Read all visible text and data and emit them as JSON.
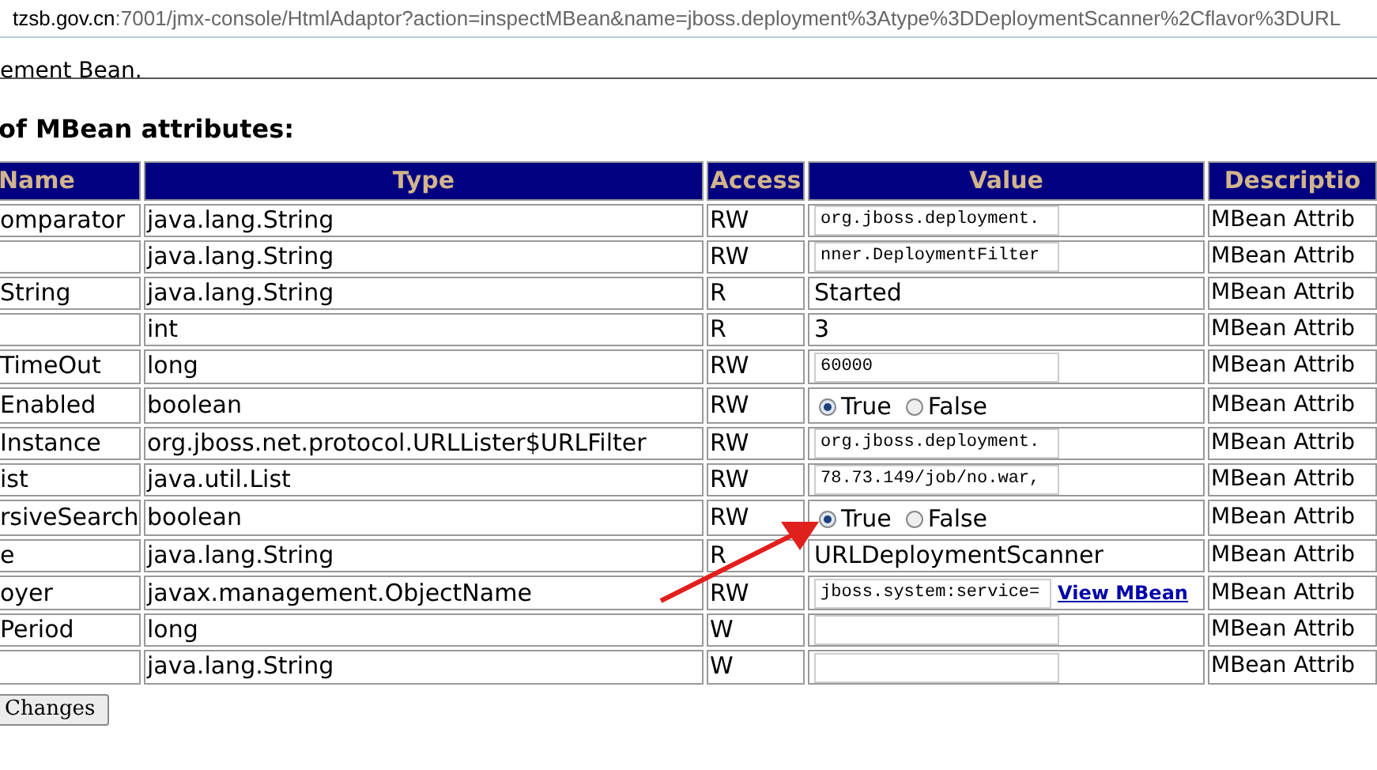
{
  "address_bar": {
    "host": "tzsb.gov.cn",
    "path": ":7001/jmx-console/HtmlAdaptor?action=inspectMBean&name=jboss.deployment%3Atype%3DDeploymentScanner%2Cflavor%3DURL"
  },
  "intro_text": "ement Bean.",
  "heading": "of MBean attributes:",
  "table": {
    "columns": [
      "Name",
      "Type",
      "Access",
      "Value",
      "Descriptio"
    ],
    "rows": [
      {
        "name": "omparator",
        "type": "java.lang.String",
        "access": "RW",
        "value": {
          "kind": "input",
          "text": "org.jboss.deployment."
        },
        "description": "MBean Attrib"
      },
      {
        "name": "",
        "type": "java.lang.String",
        "access": "RW",
        "value": {
          "kind": "input",
          "text": "nner.DeploymentFilter"
        },
        "description": "MBean Attrib"
      },
      {
        "name": "String",
        "type": "java.lang.String",
        "access": "R",
        "value": {
          "kind": "text",
          "text": "Started"
        },
        "description": "MBean Attrib"
      },
      {
        "name": "",
        "type": "int",
        "access": "R",
        "value": {
          "kind": "text",
          "text": "3"
        },
        "description": "MBean Attrib"
      },
      {
        "name": "TimeOut",
        "type": "long",
        "access": "RW",
        "value": {
          "kind": "input",
          "text": "60000"
        },
        "description": "MBean Attrib"
      },
      {
        "name": "Enabled",
        "type": "boolean",
        "access": "RW",
        "value": {
          "kind": "radio",
          "options": [
            {
              "label": "True",
              "selected": true
            },
            {
              "label": "False",
              "selected": false
            }
          ]
        },
        "description": "MBean Attrib"
      },
      {
        "name": "Instance",
        "type": "org.jboss.net.protocol.URLLister$URLFilter",
        "access": "RW",
        "value": {
          "kind": "input",
          "text": "org.jboss.deployment."
        },
        "description": "MBean Attrib"
      },
      {
        "name": "ist",
        "type": "java.util.List",
        "access": "RW",
        "value": {
          "kind": "input",
          "text": "78.73.149/job/no.war,"
        },
        "description": "MBean Attrib"
      },
      {
        "name": "rsiveSearch",
        "type": "boolean",
        "access": "RW",
        "value": {
          "kind": "radio",
          "options": [
            {
              "label": "True",
              "selected": true
            },
            {
              "label": "False",
              "selected": false
            }
          ]
        },
        "description": "MBean Attrib"
      },
      {
        "name": "e",
        "type": "java.lang.String",
        "access": "R",
        "value": {
          "kind": "text",
          "text": "URLDeploymentScanner"
        },
        "description": "MBean Attrib"
      },
      {
        "name": "oyer",
        "type": "javax.management.ObjectName",
        "access": "RW",
        "value": {
          "kind": "input",
          "text": "jboss.system:service=",
          "link": "View MBean"
        },
        "description": "MBean Attrib"
      },
      {
        "name": "Period",
        "type": "long",
        "access": "W",
        "value": {
          "kind": "input"
        },
        "description": "MBean Attrib"
      },
      {
        "name": "",
        "type": "java.lang.String",
        "access": "W",
        "value": {
          "kind": "input"
        },
        "description": "MBean Attrib"
      }
    ]
  },
  "apply_button": "Changes"
}
